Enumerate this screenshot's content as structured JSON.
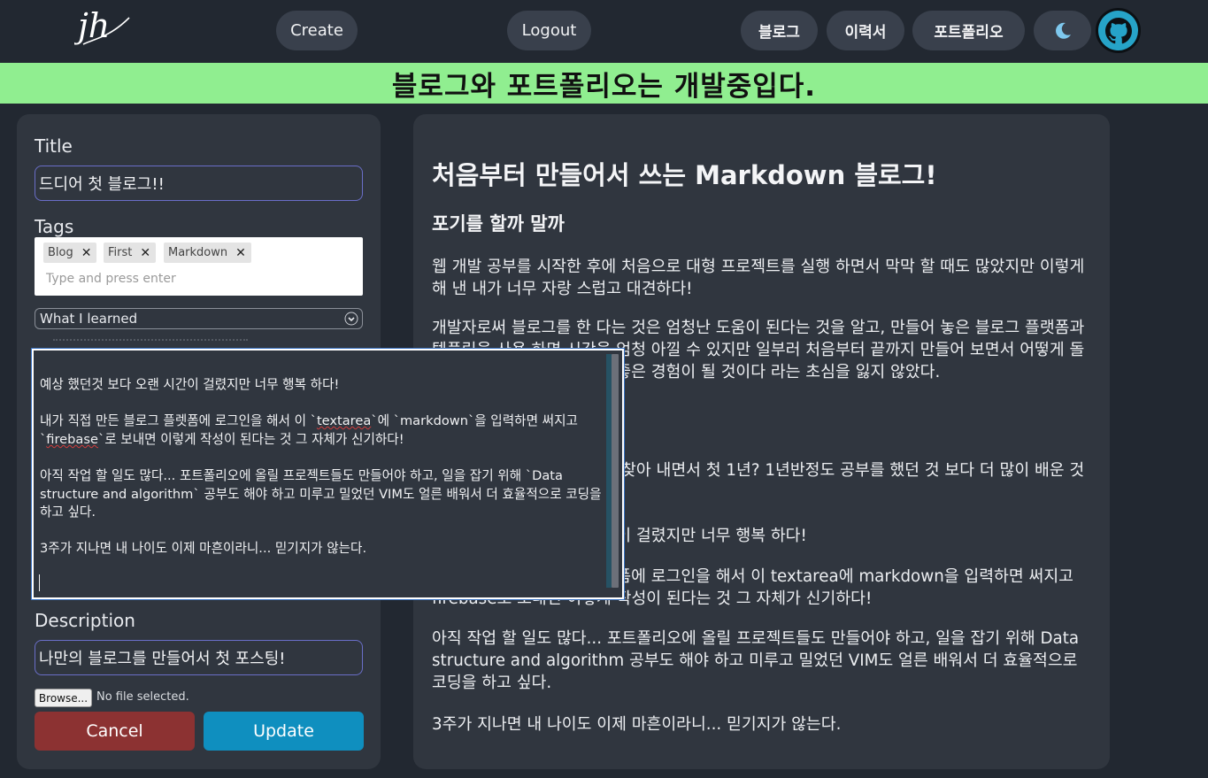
{
  "nav": {
    "logo_text": "jh",
    "create": "Create",
    "logout": "Logout",
    "blog": "블로그",
    "resume": "이력서",
    "portfolio": "포트폴리오",
    "theme_icon": "moon-icon",
    "github_icon": "github-icon"
  },
  "banner": "블로그와 포트폴리오는 개발중입다.",
  "form": {
    "title_label": "Title",
    "title_value": "드디어 첫 블로그!!",
    "tags_label": "Tags",
    "tags": [
      "Blog",
      "First",
      "Markdown"
    ],
    "tags_placeholder": "Type and press enter",
    "category_selected": "What I learned",
    "description_label": "Description",
    "description_value": "나만의 블로그를 만들어서 첫 포스팅!",
    "browse_label": "Browse...",
    "file_status": "No file selected.",
    "cancel": "Cancel",
    "update": "Update"
  },
  "textarea": {
    "p1": "예상 했던것 보다 오랜 시간이 걸렸지만 너무 행복 하다!",
    "p2_a": "내가 직접 만든 블로그 플렛폼에 로그인을 해서 이 `",
    "p2_b": "textarea",
    "p2_c": "`에 `markdown`을 입력하면 써지고 `",
    "p2_d": "firebase",
    "p2_e": "`로 보내면 이렇게 작성이 된다는 것 그 자체가 신기하다!",
    "p3": "아직 작업 할 일도 많다... 포트폴리오에 올릴 프로젝트들도 만들어야 하고, 일을 잡기 위해 `Data structure and algorithm` 공부도 해야 하고 미루고 밀었던 VIM도 얼른 배워서 더 효율적으로 코딩을 하고 싶다.",
    "p4": "3주가 지나면 내 나이도 이제 마흔이라니... 믿기지가 않는다."
  },
  "preview": {
    "title": "처음부터 만들어서 쓰는 Markdown 블로그!",
    "h2": "포기를 할까 말까",
    "p1": "웹 개발 공부를 시작한 후에 처음으로 대형 프로젝트를 실행 하면서 막막 할 때도 많았지만 이렇게 해 낸 내가 너무 자랑 스럽고 대견하다!",
    "p2": "개발자로써 블로그를 한 다는 것은 엄청난 도움이 된다는 것을 알고, 만들어 놓은 블로그 플랫폼과 템플릿을 사용 하면 시간을 엄청 아낄 수 있지만 일부러 처음부터 끝까지 만들어 보면서 어떻게 돌아가는지 하나씩 배워 가면 좋은 경험이 될 것이다 라는 초심을 잃지 않았다.",
    "p3": "공부하고, 적용하고, 버그를 찾아 내면서 첫 1년? 1년반정도 공부를 했던 것 보다 더 많이 배운 것 같다.",
    "p4": "예상 했던것 보다 오랜 시간이 걸렸지만 너무 행복 하다!",
    "p5": "내가 직접 만든 블로그 플렛폼에 로그인을 해서 이 textarea에 markdown을 입력하면 써지고 firebase로 보내면 이렇게 작성이 된다는 것 그 자체가 신기하다!",
    "p6": "아직 작업 할 일도 많다... 포트폴리오에 올릴 프로젝트들도 만들어야 하고, 일을 잡기 위해 Data structure and algorithm 공부도 해야 하고 미루고 밀었던 VIM도 얼른 배워서 더 효율적으로 코딩을 하고 싶다.",
    "p7": "3주가 지나면 내 나이도 이제 마흔이라니... 믿기지가 않는다."
  },
  "colors": {
    "background": "#222831",
    "panel": "#30363f",
    "banner": "#90ee90",
    "cancel": "#8c3232",
    "update": "#0f8fbf"
  }
}
